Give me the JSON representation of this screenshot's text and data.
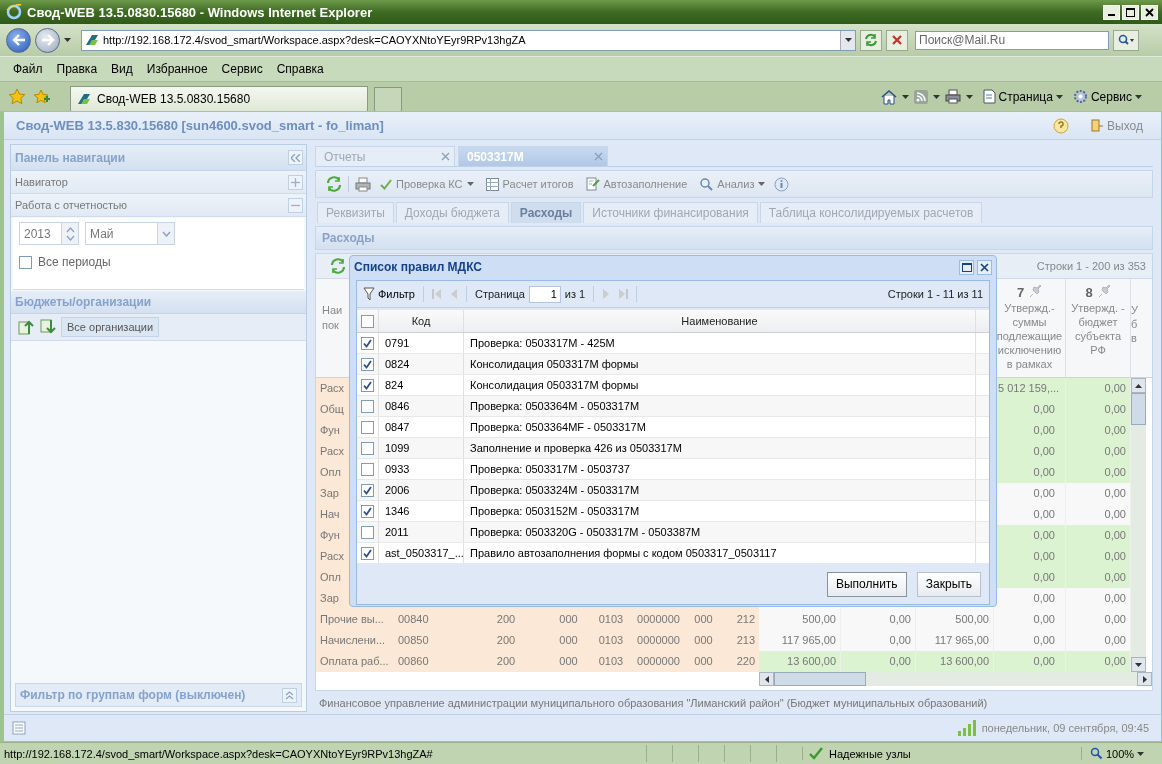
{
  "window": {
    "title": "Свод-WEB 13.5.0830.15680 - Windows Internet Explorer"
  },
  "address_bar": {
    "url": "http://192.168.172.4/svod_smart/Workspace.aspx?desk=CAOYXNtoYEyr9RPv13hgZA"
  },
  "search_box": {
    "placeholder": "Поиск@Mail.Ru"
  },
  "menu": [
    "Файл",
    "Правка",
    "Вид",
    "Избранное",
    "Сервис",
    "Справка"
  ],
  "browser_tab": {
    "title": "Свод-WEB 13.5.0830.15680"
  },
  "command_bar": [
    "Страница",
    "Сервис"
  ],
  "app": {
    "title": "Свод-WEB 13.5.830.15680 [sun4600.svod_smart - fo_liman]",
    "exit": "Выход"
  },
  "nav_panel": {
    "title": "Панель навигации",
    "sections": [
      {
        "label": "Навигатор",
        "expanded": false
      },
      {
        "label": "Работа с отчетностью",
        "expanded": true
      }
    ],
    "year": "2013",
    "month": "Май",
    "all_periods": {
      "label": "Все периоды",
      "checked": false
    },
    "budgets_title": "Бюджеты/организации",
    "organizations_button": "Все организации",
    "filter": "Фильтр по группам форм (выключен)"
  },
  "doc_tabs": [
    {
      "label": "Отчеты",
      "selected": false
    },
    {
      "label": "0503317М",
      "selected": true
    }
  ],
  "toolbar": [
    {
      "label": "Проверка КС",
      "dropdown": true
    },
    {
      "label": "Расчет итогов",
      "dropdown": false
    },
    {
      "label": "Автозаполнение",
      "dropdown": false
    },
    {
      "label": "Анализ",
      "dropdown": true
    }
  ],
  "form_tabs": [
    {
      "label": "Реквизиты",
      "selected": false
    },
    {
      "label": "Доходы бюджета",
      "selected": false
    },
    {
      "label": "Расходы",
      "selected": true
    },
    {
      "label": "Источники финансирования",
      "selected": false
    },
    {
      "label": "Таблица консолидируемых расчетов",
      "selected": false
    }
  ],
  "section_title": "Расходы",
  "table": {
    "row_count": "Строки 1 - 200 из 353",
    "columns": [
      {
        "title": "Наи пок"
      },
      {
        "number": "7",
        "title": "Утвержд.- суммы подлежащие исключению в рамках"
      },
      {
        "number": "8",
        "title": "Утвержд. - бюджет субъекта РФ"
      },
      {
        "title": "У б в"
      }
    ],
    "rows": [
      {
        "name": "Расх",
        "col7": "5 012 159,...",
        "col8": "0,00",
        "highlighted": true
      },
      {
        "name": "Общ",
        "col7": "0,00",
        "col8": "0,00",
        "highlighted": true
      },
      {
        "name": "Фун",
        "col7": "0,00",
        "col8": "0,00",
        "highlighted": true
      },
      {
        "name": "Расх",
        "col7": "0,00",
        "col8": "0,00",
        "highlighted": true
      },
      {
        "name": "Опл",
        "col7": "0,00",
        "col8": "0,00",
        "highlighted": true
      },
      {
        "name": "Зар",
        "col7": "0,00",
        "col8": "0,00",
        "highlighted": false
      },
      {
        "name": "Нач",
        "col7": "0,00",
        "col8": "0,00",
        "highlighted": false
      },
      {
        "name": "Фун",
        "col7": "0,00",
        "col8": "0,00",
        "highlighted": true
      },
      {
        "name": "Расх",
        "col7": "0,00",
        "col8": "0,00",
        "highlighted": true
      },
      {
        "name": "Опл",
        "col7": "0,00",
        "col8": "0,00",
        "highlighted": true
      },
      {
        "name": "Зар",
        "col7": "0,00",
        "col8": "0,00",
        "highlighted": false
      },
      {
        "name": "Прочие вы...",
        "codes": [
          "00840",
          "200",
          "000",
          "0103",
          "0000000",
          "000",
          "212"
        ],
        "amounts": [
          "500,00",
          "0,00",
          "500,00"
        ],
        "col7": "0,00",
        "col8": "0,00",
        "highlighted": false
      },
      {
        "name": "Начислени...",
        "codes": [
          "00850",
          "200",
          "000",
          "0103",
          "0000000",
          "000",
          "213"
        ],
        "amounts": [
          "117 965,00",
          "0,00",
          "117 965,00"
        ],
        "col7": "0,00",
        "col8": "0,00",
        "highlighted": false
      },
      {
        "name": "Оплата раб...",
        "codes": [
          "00860",
          "200",
          "000",
          "0103",
          "0000000",
          "000",
          "220"
        ],
        "amounts": [
          "13 600,00",
          "0,00",
          "13 600,00"
        ],
        "col7": "0,00",
        "col8": "0,00",
        "highlighted": true
      }
    ]
  },
  "footer": "Финансовое управление администрации муниципального образования \"Лиманский район\" (Бюджет муниципальных образований)",
  "dialog": {
    "title": "Список правил МДКС",
    "filter": "Фильтр",
    "page_label": "Страница",
    "page": "1",
    "page_total": "из 1",
    "row_count": "Строки 1 - 11 из 11",
    "columns": [
      "Код",
      "Наименование"
    ],
    "select_all": false,
    "rows": [
      {
        "code": "0791",
        "name": "Проверка: 0503317М - 425М",
        "checked": true
      },
      {
        "code": "0824",
        "name": "Консолидация 0503317М формы",
        "checked": true
      },
      {
        "code": "824",
        "name": "Консолидация 0503317М формы",
        "checked": true
      },
      {
        "code": "0846",
        "name": "Проверка: 0503364М - 0503317М",
        "checked": false
      },
      {
        "code": "0847",
        "name": "Проверка: 0503364MF - 0503317М",
        "checked": false
      },
      {
        "code": "1099",
        "name": "Заполнение и проверка 426 из 0503317М",
        "checked": false
      },
      {
        "code": "0933",
        "name": "Проверка: 0503317М - 0503737",
        "checked": false
      },
      {
        "code": "2006",
        "name": "Проверка: 0503324М - 0503317М",
        "checked": true
      },
      {
        "code": "1346",
        "name": "Проверка: 0503152М - 0503317М",
        "checked": true
      },
      {
        "code": "2011",
        "name": "Проверка: 0503320G - 0503317М - 0503387М",
        "checked": false
      },
      {
        "code": "ast_0503317_...",
        "name": "Правило автозаполнения формы с кодом 0503317_0503117",
        "checked": true
      }
    ],
    "buttons": [
      "Выполнить",
      "Закрыть"
    ]
  },
  "app_status": "понедельник, 09 сентября, 09:45",
  "ie_status": {
    "url": "http://192.168.172.4/svod_smart/Workspace.aspx?desk=CAOYXNtoYEyr9RPv13hgZA#",
    "zone": "Надежные узлы",
    "zoom": "100%"
  }
}
